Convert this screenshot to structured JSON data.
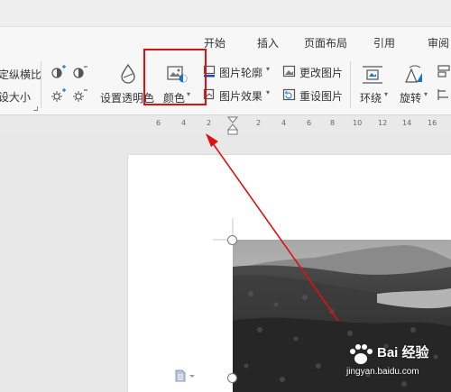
{
  "tabs": [
    {
      "label": "开始"
    },
    {
      "label": "插入"
    },
    {
      "label": "页面布局"
    },
    {
      "label": "引用"
    },
    {
      "label": "审阅"
    }
  ],
  "ribbon": {
    "lock_ratio_label": "定纵横比",
    "reset_size_label": "设大小",
    "set_transparent_label": "设置透明色",
    "color_label": "颜色",
    "picture_outline_label": "图片轮廓",
    "change_picture_label": "更改图片",
    "picture_effects_label": "图片效果",
    "reset_picture_label": "重设图片",
    "wrap_label": "环绕",
    "rotate_label": "旋转"
  },
  "ruler": {
    "ticks": [
      "6",
      "4",
      "2",
      "2",
      "4",
      "6",
      "8",
      "10",
      "12",
      "14",
      "16"
    ]
  },
  "watermark": {
    "main": "Bai 经验",
    "sub": "jingyan.baidu.com"
  },
  "colors": {
    "highlight": "#e01010",
    "arrow": "#e01010",
    "ribbon_bg": "#f7f7f7",
    "workspace_bg": "#e8e8e8"
  }
}
